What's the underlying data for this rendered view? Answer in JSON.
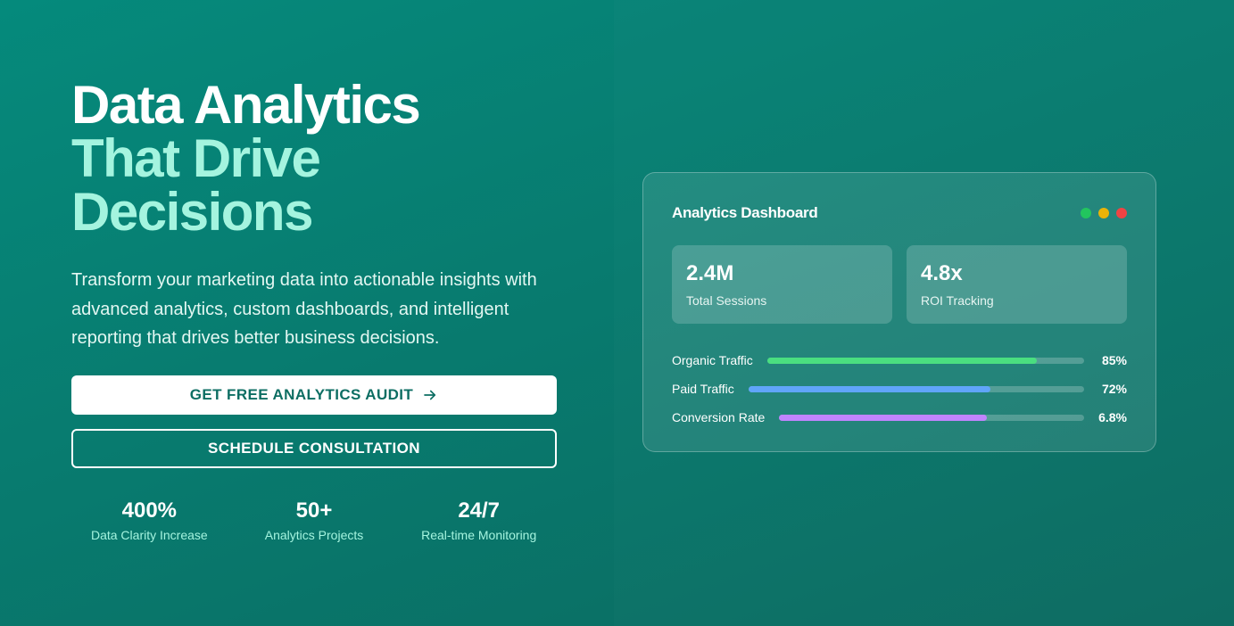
{
  "hero": {
    "headline_line1": "Data Analytics",
    "headline_accent_line2": "That Drive",
    "headline_accent_line3": "Decisions",
    "subtext": "Transform your marketing data into actionable insights with advanced analytics, custom dashboards, and intelligent reporting that drives better business decisions.",
    "primary_button_label": "GET FREE ANALYTICS AUDIT",
    "secondary_button_label": "SCHEDULE CONSULTATION",
    "stats": [
      {
        "value": "400%",
        "label": "Data Clarity Increase"
      },
      {
        "value": "50+",
        "label": "Analytics Projects"
      },
      {
        "value": "24/7",
        "label": "Real-time Monitoring"
      }
    ]
  },
  "dashboard": {
    "title": "Analytics Dashboard",
    "window_dots": [
      "#22c55e",
      "#eab308",
      "#ef4444"
    ],
    "cards": [
      {
        "value": "2.4M",
        "label": "Total Sessions"
      },
      {
        "value": "4.8x",
        "label": "ROI Tracking"
      }
    ],
    "metrics": [
      {
        "label": "Organic Traffic",
        "value": "85%",
        "fill": 0.85,
        "color": "#4ade80"
      },
      {
        "label": "Paid Traffic",
        "value": "72%",
        "fill": 0.72,
        "color": "#60a5fa"
      },
      {
        "label": "Conversion Rate",
        "value": "6.8%",
        "fill": 0.68,
        "color": "#c084fc"
      }
    ]
  },
  "icons": {
    "primary_button_icon": "arrow-right-icon"
  },
  "colors": {
    "accent": "#a4f4df",
    "brand_dark": "#0d6e63"
  }
}
